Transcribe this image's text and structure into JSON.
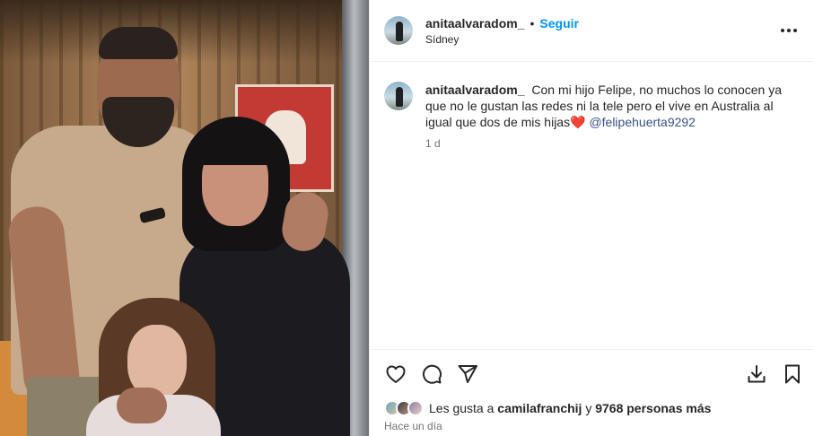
{
  "post": {
    "username": "anitaalvaradom_",
    "follow_label": "Seguir",
    "separator": "•",
    "location": "Sídney",
    "caption_text": "Con mi hijo Felipe, no muchos lo conocen ya que no le gustan las redes ni la tele pero el vive en Australia al igual que dos de mis hijas",
    "caption_emoji": "❤️",
    "caption_mention": "@felipehuerta9292",
    "caption_age": "1 d",
    "likes_prefix": "Les gusta a",
    "likes_user": "camilafranchij",
    "likes_middle": "y",
    "likes_count": "9768 personas más",
    "post_time": "Hace un día"
  },
  "icons": {
    "more": "more-options-icon",
    "like": "heart-icon",
    "comment": "comment-icon",
    "share": "send-icon",
    "download": "download-icon",
    "save": "bookmark-icon"
  },
  "colors": {
    "accent": "#0095f6",
    "mention": "#385185",
    "muted": "#737373",
    "text": "#262626"
  }
}
